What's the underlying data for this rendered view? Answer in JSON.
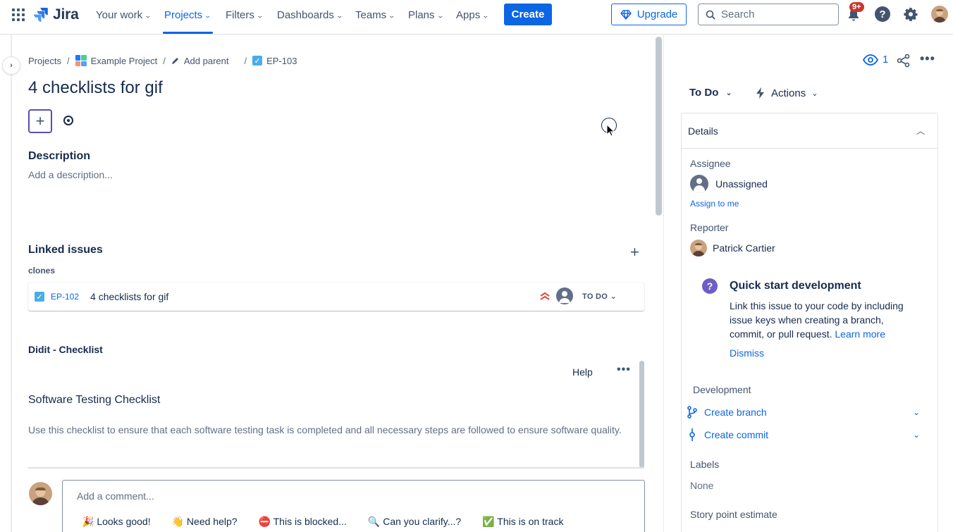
{
  "nav": {
    "logo_text": "Jira",
    "items": [
      {
        "label": "Your work"
      },
      {
        "label": "Projects"
      },
      {
        "label": "Filters"
      },
      {
        "label": "Dashboards"
      },
      {
        "label": "Teams"
      },
      {
        "label": "Plans"
      },
      {
        "label": "Apps"
      }
    ],
    "active_item": "Projects",
    "create_label": "Create",
    "upgrade_label": "Upgrade",
    "search_placeholder": "Search",
    "notification_badge": "9+",
    "colors": {
      "accent": "#0C66E4",
      "badge": "#C9372C"
    }
  },
  "breadcrumb": {
    "projects": "Projects",
    "project_name": "Example Project",
    "add_parent": "Add parent",
    "issue_key": "EP-103"
  },
  "issue": {
    "title": "4 checklists for gif",
    "description_heading": "Description",
    "description_placeholder": "Add a description...",
    "linked_heading": "Linked issues",
    "link_type": "clones",
    "linked": {
      "key": "EP-102",
      "summary": "4 checklists for gif",
      "status": "TO DO"
    },
    "didit_heading": "Didit - Checklist",
    "help_label": "Help",
    "checklist_title": "Software Testing Checklist",
    "checklist_description": "Use this checklist to ensure that each software testing task is completed and all necessary steps are followed to ensure software quality.",
    "comment_placeholder": "Add a comment...",
    "quick_replies": [
      "🎉 Looks good!",
      "👋 Need help?",
      "⛔ This is blocked...",
      "🔍 Can you clarify...?",
      "✅ This is on track"
    ]
  },
  "sidebar": {
    "watch_count": "1",
    "status_label": "To Do",
    "actions_label": "Actions",
    "details_heading": "Details",
    "assignee_label": "Assignee",
    "assignee_value": "Unassigned",
    "assign_to_me": "Assign to me",
    "reporter_label": "Reporter",
    "reporter_value": "Patrick Cartier",
    "qsd_title": "Quick start development",
    "qsd_body": "Link this issue to your code by including issue keys when creating a branch, commit, or pull request.",
    "qsd_learn_more": "Learn more",
    "dismiss_label": "Dismiss",
    "development_label": "Development",
    "create_branch": "Create branch",
    "create_commit": "Create commit",
    "labels_label": "Labels",
    "labels_value": "None",
    "story_points_label": "Story point estimate"
  }
}
